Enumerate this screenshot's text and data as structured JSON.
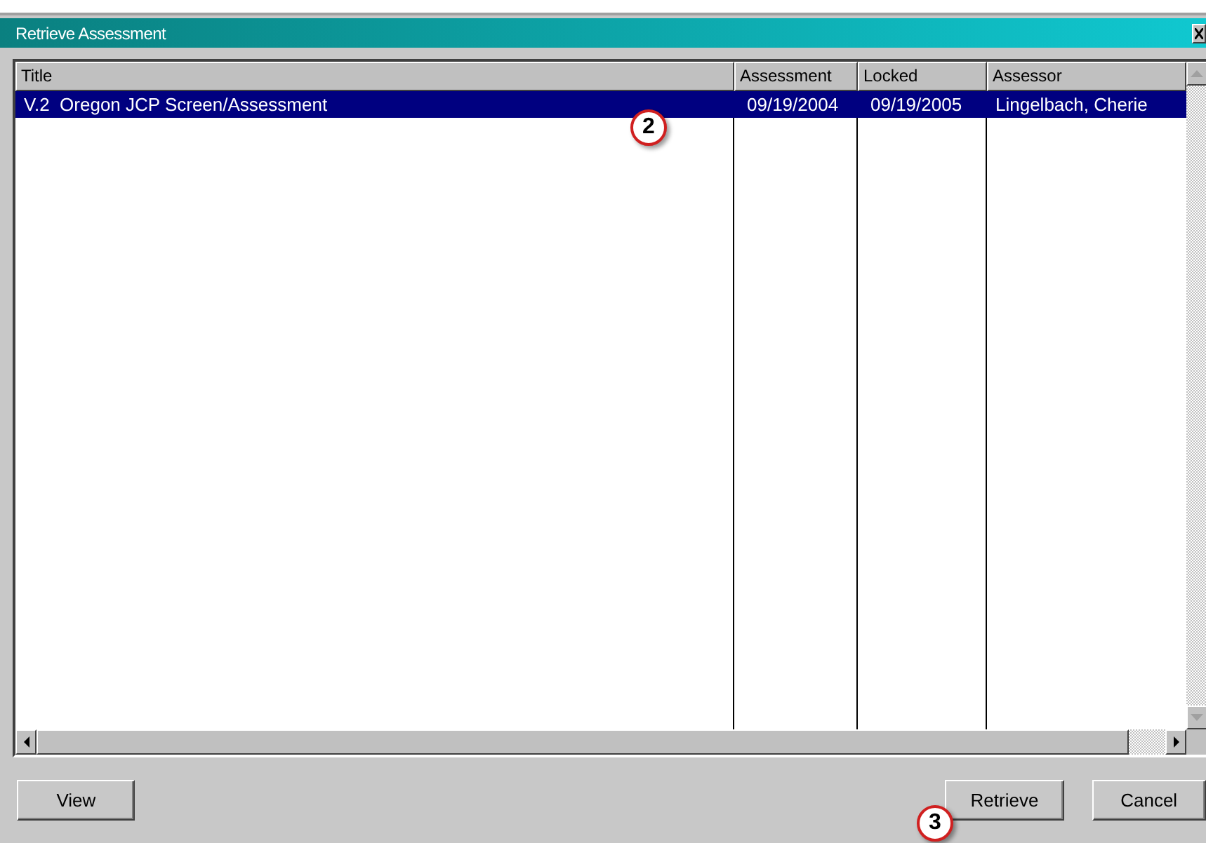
{
  "window": {
    "title": "Retrieve Assessment"
  },
  "table": {
    "columns": [
      "Title",
      "Assessment",
      "Locked",
      "Assessor"
    ],
    "rows": [
      {
        "cells": [
          "V.2  Oregon JCP Screen/Assessment",
          "09/19/2004",
          "09/19/2005",
          "Lingelbach, Cherie"
        ],
        "selected": true
      }
    ]
  },
  "buttons": [
    "View",
    "Retrieve",
    "Cancel"
  ],
  "callouts": [
    {
      "label": "2"
    },
    {
      "label": "3"
    }
  ]
}
